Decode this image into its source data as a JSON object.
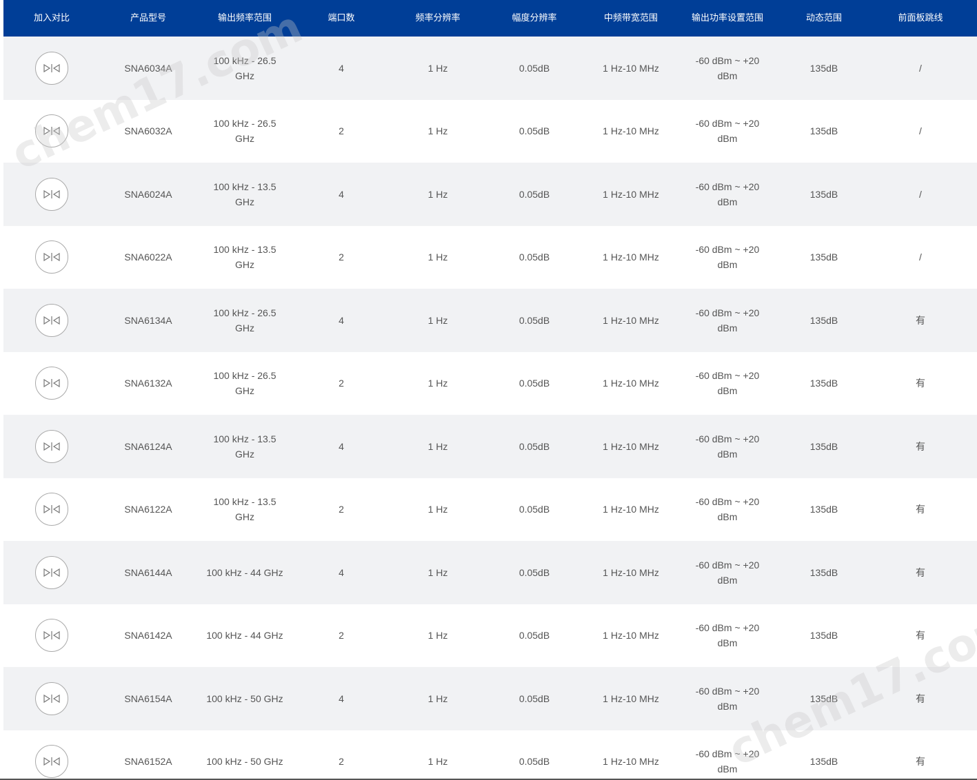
{
  "header": [
    "加入对比",
    "产品型号",
    "输出频率范围",
    "端口数",
    "频率分辨率",
    "幅度分辨率",
    "中频带宽范围",
    "输出功率设置范围",
    "动态范围",
    "前面板跳线"
  ],
  "rows": [
    {
      "model": "SNA6034A",
      "freq": "100 kHz - 26.5 GHz",
      "ports": "4",
      "fres": "1 Hz",
      "ares": "0.05dB",
      "ifbw": "1 Hz-10 MHz",
      "power": "-60 dBm ~ +20 dBm",
      "dyn": "135dB",
      "jumper": "/"
    },
    {
      "model": "SNA6032A",
      "freq": "100 kHz - 26.5 GHz",
      "ports": "2",
      "fres": "1 Hz",
      "ares": "0.05dB",
      "ifbw": "1 Hz-10 MHz",
      "power": "-60 dBm ~ +20 dBm",
      "dyn": "135dB",
      "jumper": "/"
    },
    {
      "model": "SNA6024A",
      "freq": "100 kHz - 13.5 GHz",
      "ports": "4",
      "fres": "1 Hz",
      "ares": "0.05dB",
      "ifbw": "1 Hz-10 MHz",
      "power": "-60 dBm ~ +20 dBm",
      "dyn": "135dB",
      "jumper": "/"
    },
    {
      "model": "SNA6022A",
      "freq": "100 kHz - 13.5 GHz",
      "ports": "2",
      "fres": "1 Hz",
      "ares": "0.05dB",
      "ifbw": "1 Hz-10 MHz",
      "power": "-60 dBm ~ +20 dBm",
      "dyn": "135dB",
      "jumper": "/"
    },
    {
      "model": "SNA6134A",
      "freq": "100 kHz - 26.5 GHz",
      "ports": "4",
      "fres": "1 Hz",
      "ares": "0.05dB",
      "ifbw": "1 Hz-10 MHz",
      "power": "-60 dBm ~ +20 dBm",
      "dyn": "135dB",
      "jumper": "有"
    },
    {
      "model": "SNA6132A",
      "freq": "100 kHz - 26.5 GHz",
      "ports": "2",
      "fres": "1 Hz",
      "ares": "0.05dB",
      "ifbw": "1 Hz-10 MHz",
      "power": "-60 dBm ~ +20 dBm",
      "dyn": "135dB",
      "jumper": "有"
    },
    {
      "model": "SNA6124A",
      "freq": "100 kHz - 13.5 GHz",
      "ports": "4",
      "fres": "1 Hz",
      "ares": "0.05dB",
      "ifbw": "1 Hz-10 MHz",
      "power": "-60 dBm ~ +20 dBm",
      "dyn": "135dB",
      "jumper": "有"
    },
    {
      "model": "SNA6122A",
      "freq": "100 kHz - 13.5 GHz",
      "ports": "2",
      "fres": "1 Hz",
      "ares": "0.05dB",
      "ifbw": "1 Hz-10 MHz",
      "power": "-60 dBm ~ +20 dBm",
      "dyn": "135dB",
      "jumper": "有"
    },
    {
      "model": "SNA6144A",
      "freq": "100 kHz - 44 GHz",
      "ports": "4",
      "fres": "1 Hz",
      "ares": "0.05dB",
      "ifbw": "1 Hz-10 MHz",
      "power": "-60 dBm ~ +20 dBm",
      "dyn": "135dB",
      "jumper": "有"
    },
    {
      "model": "SNA6142A",
      "freq": "100 kHz - 44 GHz",
      "ports": "2",
      "fres": "1 Hz",
      "ares": "0.05dB",
      "ifbw": "1 Hz-10 MHz",
      "power": "-60 dBm ~ +20 dBm",
      "dyn": "135dB",
      "jumper": "有"
    },
    {
      "model": "SNA6154A",
      "freq": "100 kHz - 50 GHz",
      "ports": "4",
      "fres": "1 Hz",
      "ares": "0.05dB",
      "ifbw": "1 Hz-10 MHz",
      "power": "-60 dBm ~ +20 dBm",
      "dyn": "135dB",
      "jumper": "有"
    },
    {
      "model": "SNA6152A",
      "freq": "100 kHz - 50 GHz",
      "ports": "2",
      "fres": "1 Hz",
      "ares": "0.05dB",
      "ifbw": "1 Hz-10 MHz",
      "power": "-60 dBm ~ +20 dBm",
      "dyn": "135dB",
      "jumper": "有"
    }
  ],
  "compare_icon": "compare-icon",
  "watermark": "chem17.com",
  "colors": {
    "header_bg": "#003e97",
    "header_text": "#ffffff",
    "row_alt_bg": "#f1f2f4",
    "text": "#555555"
  }
}
